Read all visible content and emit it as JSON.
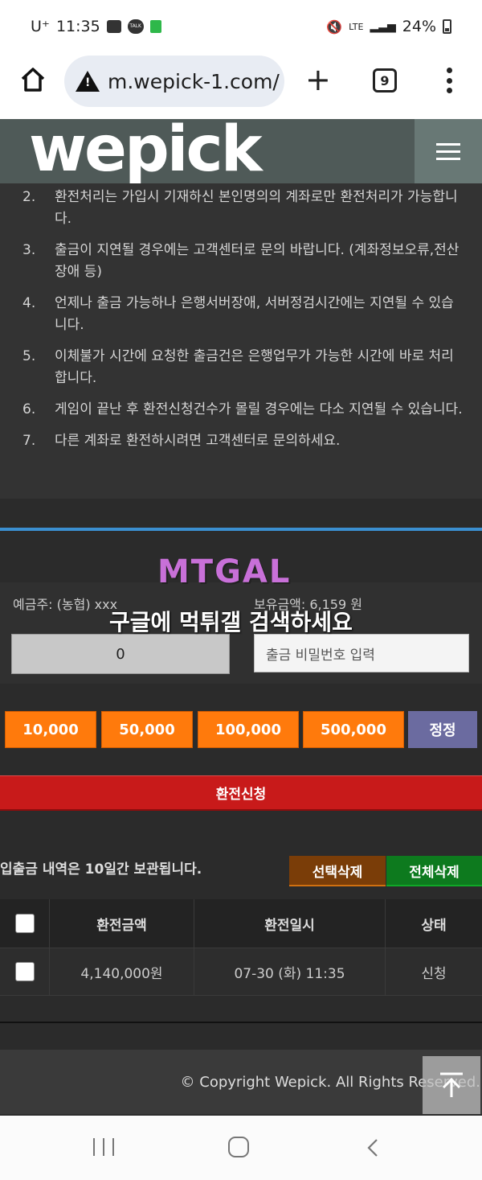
{
  "status_bar": {
    "carrier": "U⁺",
    "time": "11:35",
    "network": "LTE",
    "battery": "24%"
  },
  "browser": {
    "url": "m.wepick-1.com/",
    "tab_count": "9"
  },
  "site": {
    "logo": "wepick"
  },
  "notices": [
    {
      "num": "2.",
      "text": "환전처리는 가입시 기재하신 본인명의의 계좌로만 환전처리가 가능합니다."
    },
    {
      "num": "3.",
      "text": "출금이 지연될 경우에는 고객센터로 문의 바랍니다. (계좌정보오류,전산장애 등)"
    },
    {
      "num": "4.",
      "text": "언제나 출금 가능하나 은행서버장애, 서버정검시간에는 지연될 수 있습니다."
    },
    {
      "num": "5.",
      "text": "이체불가 시간에 요청한 출금건은 은행업무가 가능한 시간에 바로 처리합니다."
    },
    {
      "num": "6.",
      "text": "게임이 끝난 후 환전신청건수가 몰릴 경우에는 다소 지연될 수 있습니다."
    },
    {
      "num": "7.",
      "text": "다른 계좌로 환전하시려면 고객센터로 문의하세요."
    }
  ],
  "watermark": {
    "logo": "MTGAL",
    "text": "구글에 먹튀갤 검색하세요"
  },
  "account": {
    "depositor": "예금주: (농협) xxx",
    "balance": "보유금액: 6,159 원",
    "amount_value": "0",
    "password_placeholder": "출금 비밀번호 입력"
  },
  "amount_buttons": [
    "10,000",
    "50,000",
    "100,000",
    "500,000"
  ],
  "reset_label": "정정",
  "apply_label": "환전신청",
  "history": {
    "note": "입출금 내역은 10일간 보관됩니다.",
    "select_delete": "선택삭제",
    "delete_all": "전체삭제",
    "columns": [
      "환전금액",
      "환전일시",
      "상태"
    ],
    "rows": [
      {
        "amount": "4,140,000원",
        "datetime": "07-30 (화) 11:35",
        "status": "신청"
      }
    ]
  },
  "footer": {
    "copyright": "© Copyright Wepick. All Rights Reserved."
  }
}
